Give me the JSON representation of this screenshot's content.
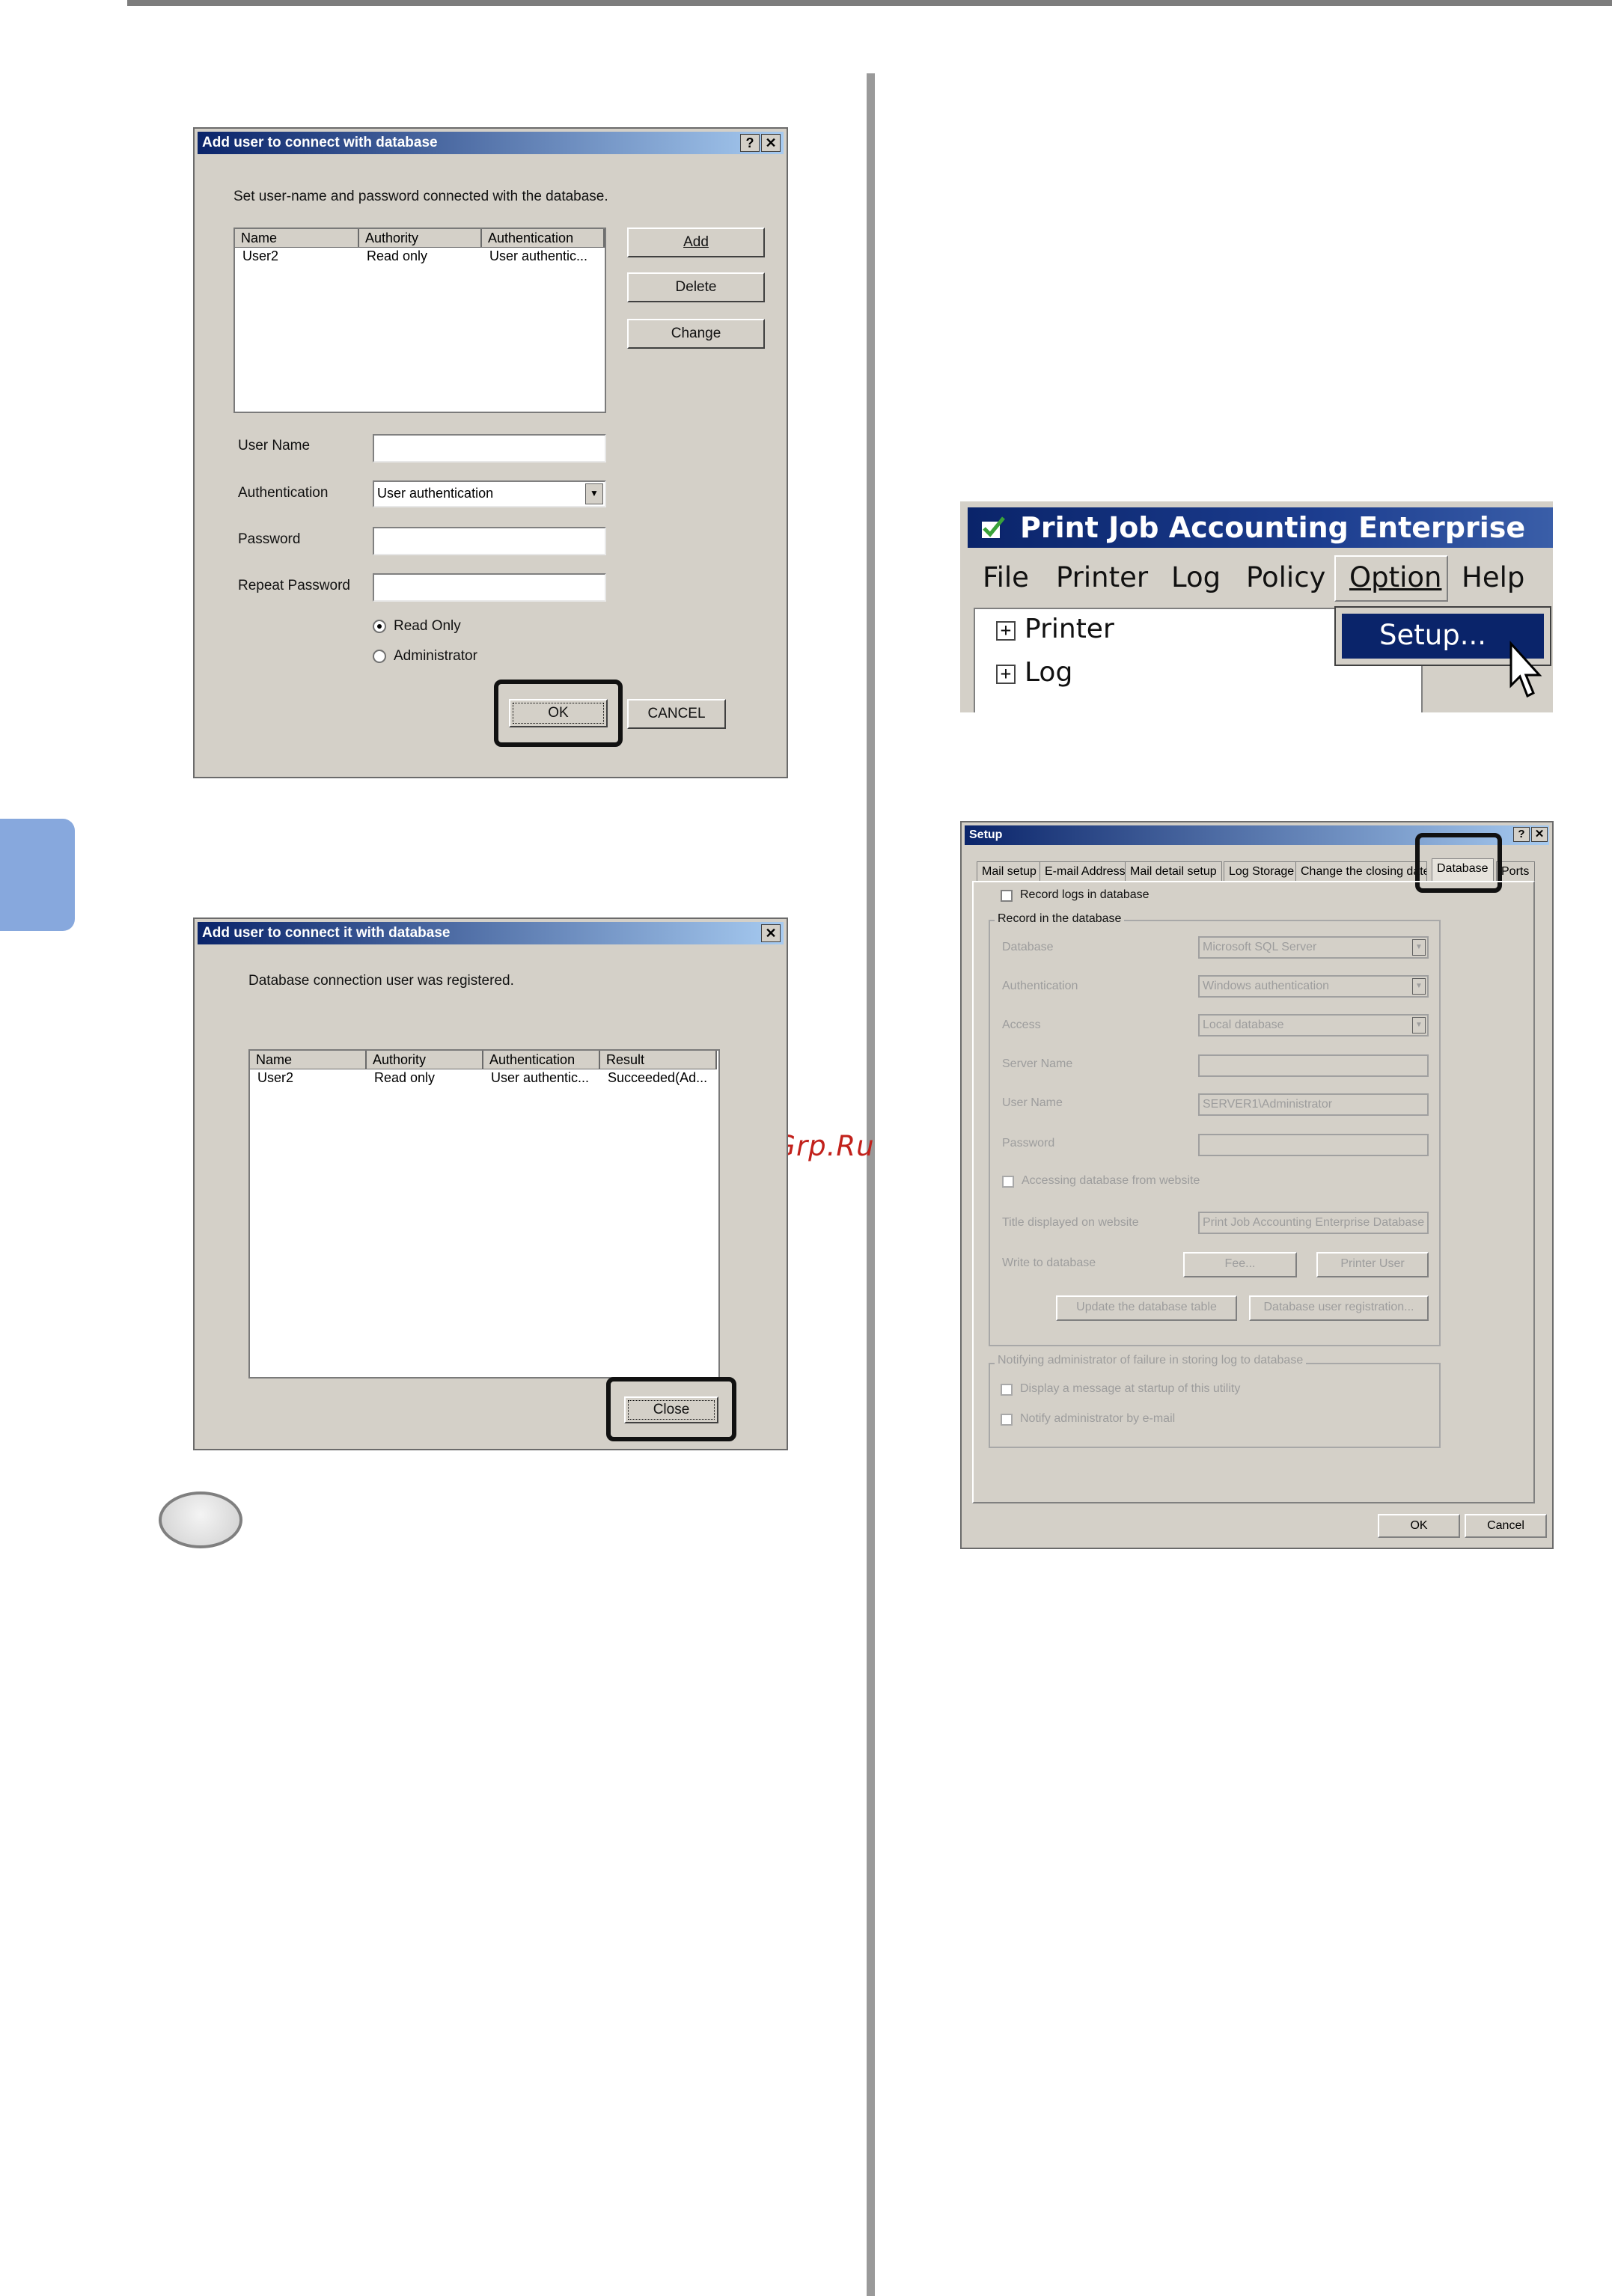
{
  "watermark": "McGrp.Ru",
  "dialog1": {
    "title": "Add user to connect with database",
    "help_btn": "?",
    "close_btn": "✕",
    "instruction": "Set user-name and password connected with the database.",
    "columns": [
      "Name",
      "Authority",
      "Authentication"
    ],
    "rows": [
      [
        "User2",
        "Read only",
        "User authentic..."
      ]
    ],
    "add_label": "Add",
    "delete_label": "Delete",
    "change_label": "Change",
    "username_label": "User Name",
    "authentication_label": "Authentication",
    "authentication_value": "User authentication",
    "password_label": "Password",
    "repeat_password_label": "Repeat Password",
    "radio_readonly": "Read Only",
    "radio_admin": "Administrator",
    "ok_label": "OK",
    "cancel_label": "CANCEL"
  },
  "dialog2": {
    "title": "Add user to connect it with database",
    "close_btn": "✕",
    "message": "Database connection user was registered.",
    "columns": [
      "Name",
      "Authority",
      "Authentication",
      "Result"
    ],
    "rows": [
      [
        "User2",
        "Read only",
        "User authentic...",
        "Succeeded(Ad..."
      ]
    ],
    "close_label": "Close"
  },
  "app_menu": {
    "title": "Print Job Accounting Enterprise",
    "menus": [
      "File",
      "Printer",
      "Log",
      "Policy",
      "Option",
      "Help"
    ],
    "tree": [
      "Printer",
      "Log"
    ],
    "dropdown_item": "Setup..."
  },
  "setup": {
    "title": "Setup",
    "help_btn": "?",
    "close_btn": "✕",
    "tabs": [
      "Mail setup",
      "E-mail Address",
      "Mail detail setup",
      "Log Storage",
      "Change the closing date",
      "Database",
      "Ports"
    ],
    "record_logs": "Record logs in database",
    "group_title": "Record in the database",
    "database_label": "Database",
    "database_value": "Microsoft SQL Server",
    "auth_label": "Authentication",
    "auth_value": "Windows authentication",
    "access_label": "Access",
    "access_value": "Local database",
    "server_label": "Server Name",
    "server_value": "",
    "user_label": "User Name",
    "user_value": "SERVER1\\Administrator",
    "password_label": "Password",
    "password_value": "",
    "website_chk": "Accessing database from website",
    "title_label": "Title displayed on website",
    "title_value": "Print Job Accounting Enterprise Database",
    "write_label": "Write to database",
    "fee_btn": "Fee...",
    "printer_user_btn": "Printer User",
    "update_btn": "Update the database table",
    "registration_btn": "Database user registration...",
    "notify_group": "Notifying administrator of failure in storing log to database",
    "display_msg": "Display a message at startup of this utility",
    "notify_email": "Notify administrator by e-mail",
    "ok_label": "OK",
    "cancel_label": "Cancel"
  }
}
